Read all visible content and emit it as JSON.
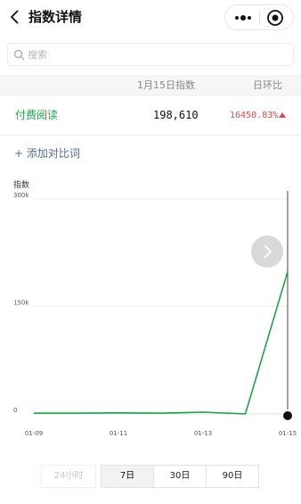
{
  "nav": {
    "title": "指数详情"
  },
  "search": {
    "placeholder": "搜索"
  },
  "table": {
    "col_date": "1月15日指数",
    "col_ratio": "日环比",
    "row": {
      "name": "付费阅读",
      "value": "198,610",
      "change": "16450.83%"
    }
  },
  "add_compare": "+ 添加对比词",
  "colors": {
    "line": "#1ea24a",
    "up": "#d94a4a",
    "link": "#556c8f"
  },
  "chart_data": {
    "type": "line",
    "ylabel": "指数",
    "x": [
      "01-09",
      "01-10",
      "01-11",
      "01-12",
      "01-13",
      "01-14",
      "01-15"
    ],
    "x_tick_labels": [
      "01-09",
      "01-11",
      "01-13",
      "01-15"
    ],
    "y_tick_labels": [
      "300k",
      "150k",
      "0"
    ],
    "ylim": [
      0,
      300000
    ],
    "series": [
      {
        "values": [
          1000,
          1000,
          1500,
          1000,
          2500,
          0,
          198610
        ]
      }
    ],
    "grid": true
  },
  "range": {
    "options": [
      "24小时",
      "7日",
      "30日",
      "90日"
    ],
    "selected": "7日"
  }
}
